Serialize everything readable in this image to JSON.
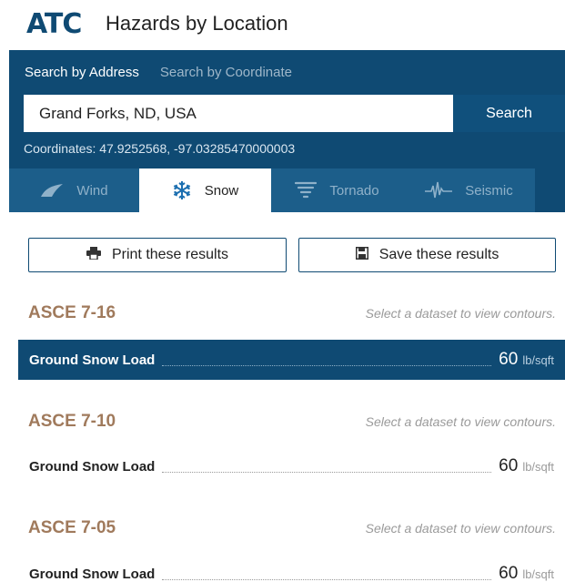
{
  "header": {
    "logo_text": "ATC",
    "title": "Hazards by Location"
  },
  "search": {
    "tabs": [
      {
        "label": "Search by Address",
        "active": true
      },
      {
        "label": "Search by Coordinate",
        "active": false
      }
    ],
    "input_value": "Grand Forks, ND, USA",
    "button_label": "Search",
    "coordinates_text": "Coordinates: 47.9252568, -97.03285470000003"
  },
  "hazard_tabs": [
    {
      "label": "Wind",
      "icon": "wind-icon",
      "active": false
    },
    {
      "label": "Snow",
      "icon": "snowflake-icon",
      "active": true
    },
    {
      "label": "Tornado",
      "icon": "tornado-icon",
      "active": false
    },
    {
      "label": "Seismic",
      "icon": "seismic-icon",
      "active": false
    }
  ],
  "actions": {
    "print_label": "Print these results",
    "print_icon": "printer-icon",
    "save_label": "Save these results",
    "save_icon": "floppy-disk-icon"
  },
  "standards": [
    {
      "title": "ASCE 7-16",
      "note": "Select a dataset to view contours.",
      "results": [
        {
          "label": "Ground Snow Load",
          "value": "60",
          "unit": "lb/sqft",
          "selected": true
        }
      ]
    },
    {
      "title": "ASCE 7-10",
      "note": "Select a dataset to view contours.",
      "results": [
        {
          "label": "Ground Snow Load",
          "value": "60",
          "unit": "lb/sqft",
          "selected": false
        }
      ]
    },
    {
      "title": "ASCE 7-05",
      "note": "Select a dataset to view contours.",
      "results": [
        {
          "label": "Ground Snow Load",
          "value": "60",
          "unit": "lb/sqft",
          "selected": false
        }
      ]
    }
  ],
  "colors": {
    "brand_blue": "#0f4a73",
    "tab_inactive": "#1c5e8a",
    "standard_title": "#a07a5c",
    "muted_text": "#9a9a9a"
  }
}
